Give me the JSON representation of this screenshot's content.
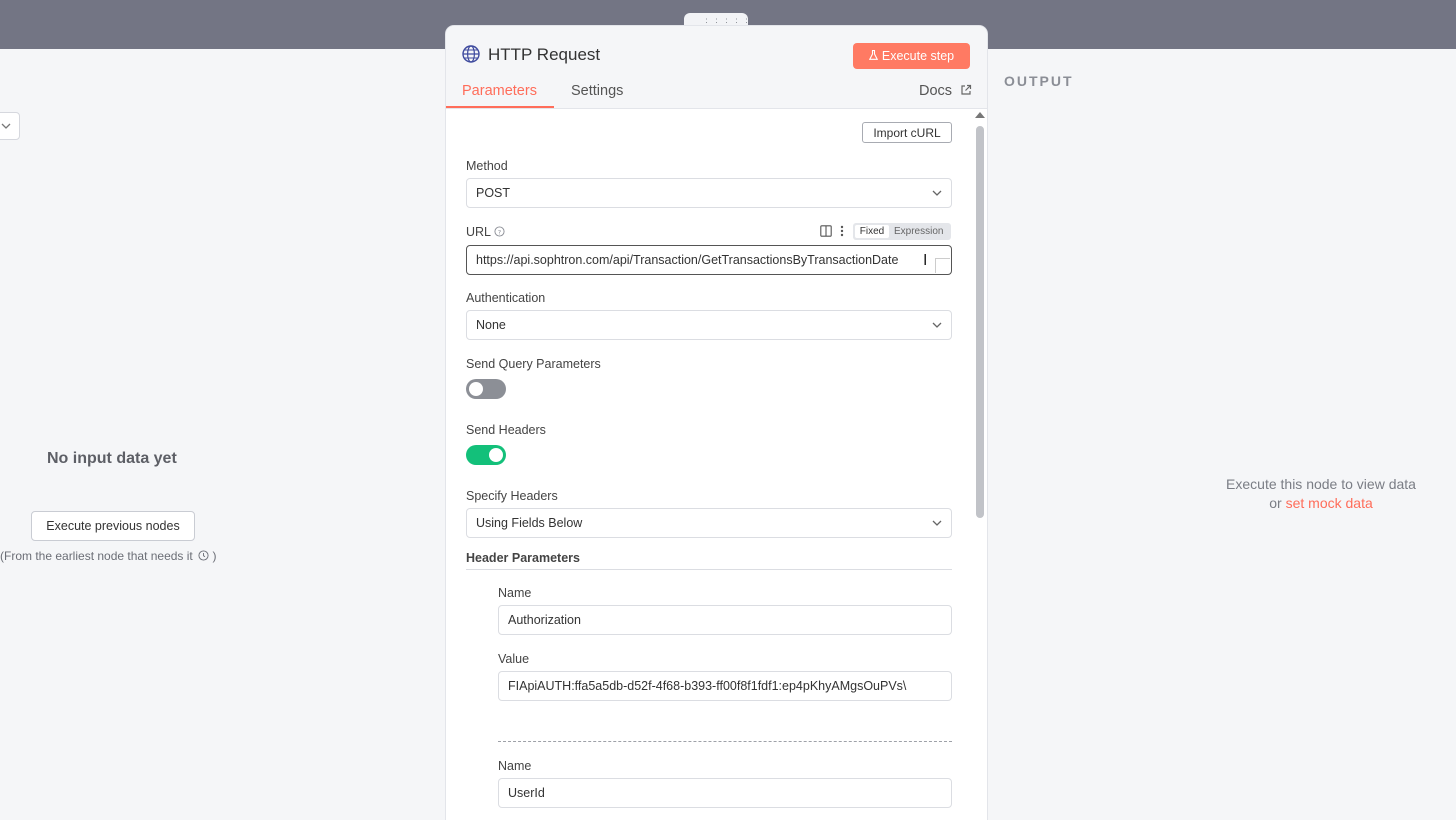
{
  "panel": {
    "title": "HTTP Request",
    "execute_step_label": "Execute step",
    "tabs": [
      {
        "label": "Parameters",
        "active": true
      },
      {
        "label": "Settings",
        "active": false
      }
    ],
    "docs_label": "Docs",
    "import_curl_label": "Import cURL",
    "method": {
      "label": "Method",
      "value": "POST"
    },
    "url": {
      "label": "URL",
      "value": "https://api.sophtron.com/api/Transaction/GetTransactionsByTransactionDate",
      "mode_fixed": "Fixed",
      "mode_expression": "Expression",
      "selected_mode": "Fixed"
    },
    "authentication": {
      "label": "Authentication",
      "value": "None"
    },
    "send_query_parameters": {
      "label": "Send Query Parameters",
      "enabled": false
    },
    "send_headers": {
      "label": "Send Headers",
      "enabled": true
    },
    "specify_headers": {
      "label": "Specify Headers",
      "value": "Using Fields Below"
    },
    "header_parameters": {
      "title": "Header Parameters",
      "items": [
        {
          "name_label": "Name",
          "name": "Authorization",
          "value_label": "Value",
          "value": "FIApiAUTH:ffa5a5db-d52f-4f68-b393-ff00f8f1fdf1:ep4pKhyAMgsOuPVs\\"
        },
        {
          "name_label": "Name",
          "name": "UserId"
        }
      ]
    }
  },
  "input_pane": {
    "empty_title": "No input data yet",
    "execute_previous_label": "Execute previous nodes",
    "hint": "(From the earliest node that needs it",
    "hint_close": ")"
  },
  "output_pane": {
    "title": "OUTPUT",
    "message_line1": "Execute this node to view data",
    "message_or": "or",
    "mock_link": "set mock data"
  },
  "colors": {
    "accent": "#ff6d5a",
    "toggle_on": "#13c07a",
    "toggle_off": "#8c8f96",
    "topbar": "#737584"
  }
}
